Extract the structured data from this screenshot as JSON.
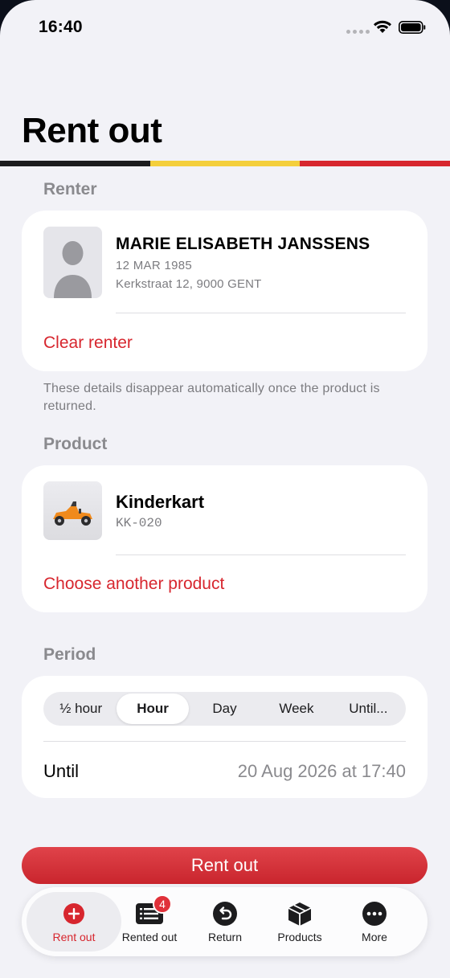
{
  "status_bar": {
    "time": "16:40"
  },
  "page": {
    "title": "Rent out"
  },
  "renter_section": {
    "label": "Renter",
    "name": "MARIE ELISABETH JANSSENS",
    "dob": "12 MAR 1985",
    "address": "Kerkstraat 12, 9000 GENT",
    "clear_label": "Clear renter",
    "hint": "These details disappear automatically once the product is returned."
  },
  "product_section": {
    "label": "Product",
    "name": "Kinderkart",
    "code": "KK-020",
    "choose_label": "Choose another product"
  },
  "period_section": {
    "label": "Period",
    "options": [
      "½ hour",
      "Hour",
      "Day",
      "Week",
      "Until..."
    ],
    "selected": "Hour",
    "until_label": "Until",
    "until_value": "20 Aug 2026 at 17:40"
  },
  "primary_button": {
    "label": "Rent out"
  },
  "tab_bar": {
    "items": [
      {
        "label": "Rent out",
        "icon": "plus-circle-icon",
        "active": true
      },
      {
        "label": "Rented out",
        "icon": "list-icon",
        "badge": "4"
      },
      {
        "label": "Return",
        "icon": "return-arrow-icon"
      },
      {
        "label": "Products",
        "icon": "box-icon"
      },
      {
        "label": "More",
        "icon": "ellipsis-circle-icon"
      }
    ]
  },
  "colors": {
    "accent": "#d7262e",
    "flag_black": "#1c1c1e",
    "flag_yellow": "#f4cf3c",
    "flag_red": "#d7262e"
  }
}
